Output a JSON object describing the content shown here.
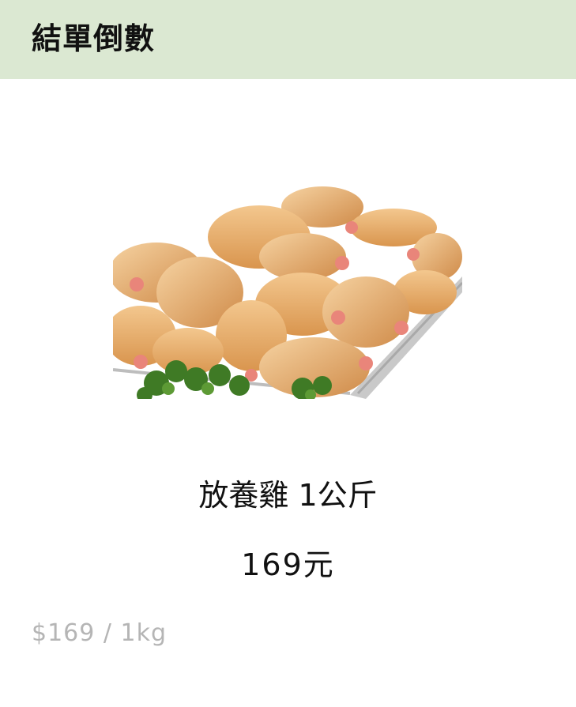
{
  "header": {
    "title": "結單倒數"
  },
  "product": {
    "image_alt": "chicken-image",
    "name": "放養雞 1公斤",
    "price": "169元",
    "unit_price": "$169 / 1kg"
  },
  "colors": {
    "header_bg": "#dbe8d2",
    "text_primary": "#111111",
    "text_muted": "#b5b5b5"
  }
}
